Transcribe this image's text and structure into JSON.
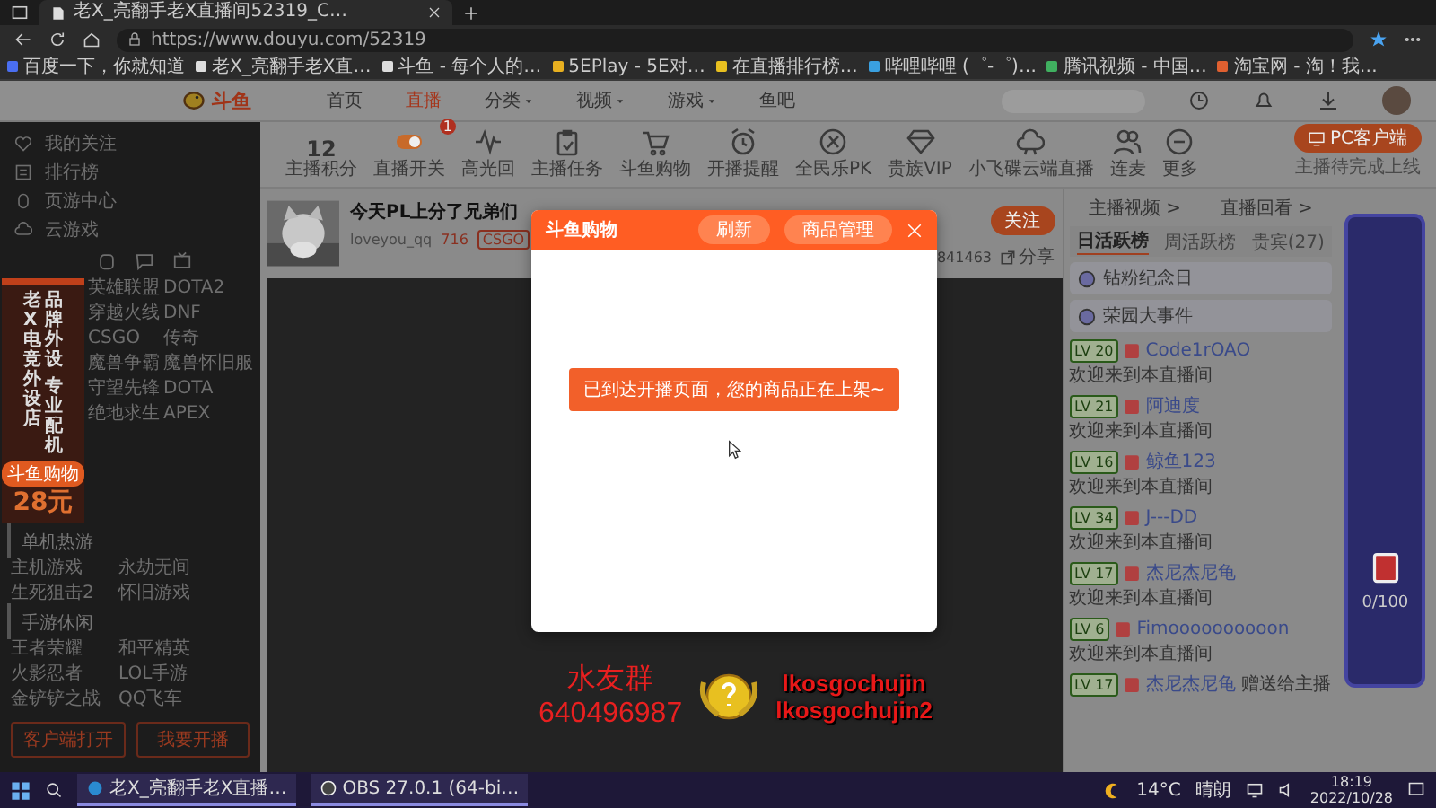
{
  "browser": {
    "tab": {
      "title": "老X_亮翻手老X直播间52319_C…"
    },
    "address": "https://www.douyu.com/52319",
    "bookmarks": [
      "百度一下，你就知道",
      "老X_亮翻手老X直…",
      "斗鱼 - 每个人的…",
      "5EPlay - 5E对…",
      "在直播排行榜…",
      "哔哩哔哩 (゜-゜)…",
      "腾讯视频 - 中国…",
      "淘宝网 - 淘！我…"
    ]
  },
  "header": {
    "logo": "斗鱼",
    "nav": [
      {
        "label": "首页",
        "selected": false,
        "dropdown": false
      },
      {
        "label": "直播",
        "selected": true,
        "dropdown": false
      },
      {
        "label": "分类",
        "selected": false,
        "dropdown": true
      },
      {
        "label": "视频",
        "selected": false,
        "dropdown": true
      },
      {
        "label": "游戏",
        "selected": false,
        "dropdown": true
      },
      {
        "label": "鱼吧",
        "selected": false,
        "dropdown": false
      }
    ]
  },
  "sidebar": {
    "nav": [
      "我的关注",
      "排行榜",
      "页游中心",
      "云游戏"
    ],
    "promo": {
      "shop": "老X电竞外设店",
      "lines": [
        "品牌外设",
        "专业配机"
      ],
      "badge": "斗鱼购物",
      "price": "28元"
    },
    "sections": [
      {
        "items": [
          "英雄联盟",
          "DOTA2",
          "穿越火线",
          "DNF",
          "CSGO",
          "传奇",
          "魔兽争霸",
          "魔兽怀旧服",
          "守望先锋",
          "DOTA",
          "绝地求生",
          "APEX"
        ]
      },
      {
        "title": "单机热游",
        "items": [
          "主机游戏",
          "永劫无间",
          "生死狙击2",
          "怀旧游戏"
        ]
      },
      {
        "title": "手游休闲",
        "items": [
          "王者荣耀",
          "和平精英",
          "火影忍者",
          "LOL手游",
          "金铲铲之战",
          "QQ飞车"
        ]
      }
    ],
    "buttons": [
      "客户端打开",
      "我要开播"
    ]
  },
  "toolbar": {
    "score": "12",
    "score_label": "主播积分",
    "items": [
      {
        "label": "直播开关",
        "badge": "1"
      },
      {
        "label": "高光回"
      },
      {
        "label": "主播任务"
      },
      {
        "label": "斗鱼购物"
      },
      {
        "label": "开播提醒"
      },
      {
        "label": "全民乐PK"
      },
      {
        "label": "贵族VIP"
      },
      {
        "label": "小飞碟云端直播"
      },
      {
        "label": "连麦"
      },
      {
        "label": "更多"
      }
    ],
    "pc_button": "PC客户端",
    "pc_note": "主播待完成上线"
  },
  "room": {
    "title": "今天PL上分了兄弟们",
    "owner": "loveyou_qq",
    "heat": "716",
    "category": "CSGO",
    "followers": "841463",
    "follow": "关注",
    "share": "分享"
  },
  "chat": {
    "links": [
      "主播视频 >",
      "直播回看 >"
    ],
    "tabs": [
      {
        "label": "日活跃榜",
        "selected": true
      },
      {
        "label": "周活跃榜",
        "selected": false
      },
      {
        "label": "贵宾(27)",
        "selected": false
      }
    ],
    "events": [
      "钻粉纪念日",
      "荣园大事件"
    ],
    "messages": [
      {
        "level": "LV 20",
        "user": "Code1rOAO",
        "text": "欢迎来到本直播间"
      },
      {
        "level": "LV 21",
        "user": "阿迪度",
        "text": "欢迎来到本直播间"
      },
      {
        "level": "LV 16",
        "user": "鲸鱼123",
        "text": "欢迎来到本直播间"
      },
      {
        "level": "LV 34",
        "user": "J---DD",
        "text": "欢迎来到本直播间"
      },
      {
        "level": "LV 17",
        "user": "杰尼杰尼龟",
        "text": "欢迎来到本直播间"
      },
      {
        "level": "LV 6",
        "user": "Fimoooooooooon",
        "text": "欢迎来到本直播间"
      },
      {
        "level": "LV 17",
        "user": "杰尼杰尼龟",
        "text": "赠送给主播"
      }
    ]
  },
  "overlay": {
    "group_label": "水友群",
    "group_number": "640496987",
    "names": [
      "lkosgochujin",
      "lkosgochujin2"
    ],
    "progress": "0/100"
  },
  "modal": {
    "title": "斗鱼购物",
    "buttons": [
      "刷新",
      "商品管理"
    ],
    "toast": "已到达开播页面，您的商品正在上架~"
  },
  "taskbar": {
    "tasks": [
      "老X_亮翻手老X直播…",
      "OBS 27.0.1 (64-bi…"
    ],
    "temperature": "14°C",
    "weather": "晴朗",
    "time": "18:19",
    "date": "2022/10/28"
  }
}
